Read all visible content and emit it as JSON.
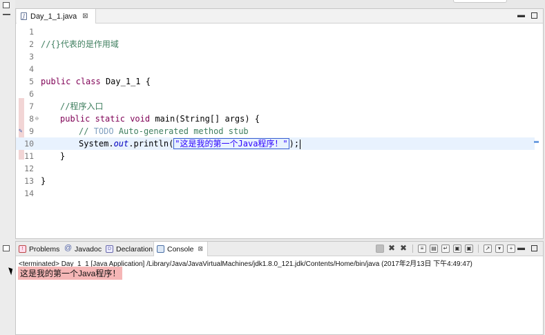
{
  "editor": {
    "tab_title": "Day_1_1.java",
    "file_icon_letter": "J",
    "close_glyph": "⊠",
    "lines": [
      {
        "n": "1"
      },
      {
        "n": "2",
        "comment": "//{}代表的是作用域"
      },
      {
        "n": "3"
      },
      {
        "n": "4"
      },
      {
        "n": "5",
        "kw1": "public",
        "kw2": "class",
        "rest": " Day_1_1 {"
      },
      {
        "n": "6"
      },
      {
        "n": "7",
        "comment": "//程序入口"
      },
      {
        "n": "8",
        "kw1": "public",
        "kw2": "static",
        "kw3": "void",
        "rest": " main(String[] args) {"
      },
      {
        "n": "9",
        "cm_prefix": "// ",
        "todo": "TODO",
        "cm_rest": " Auto-generated method stub"
      },
      {
        "n": "10",
        "pre": "System.",
        "field": "out",
        "mid": ".println(",
        "string": "\"这是我的第一个Java程序！\"",
        "post": ");"
      },
      {
        "n": "11",
        "rest": "}"
      },
      {
        "n": "12"
      },
      {
        "n": "13",
        "rest": "}"
      },
      {
        "n": "14"
      }
    ]
  },
  "console": {
    "tabs": {
      "problems": "Problems",
      "javadoc": "Javadoc",
      "declaration": "Declaration",
      "console": "Console"
    },
    "status": "<terminated> Day_1_1 [Java Application] /Library/Java/JavaVirtualMachines/jdk1.8.0_121.jdk/Contents/Home/bin/java (2017年2月13日 下午4:49:47)",
    "output": "这是我的第一个Java程序！"
  }
}
